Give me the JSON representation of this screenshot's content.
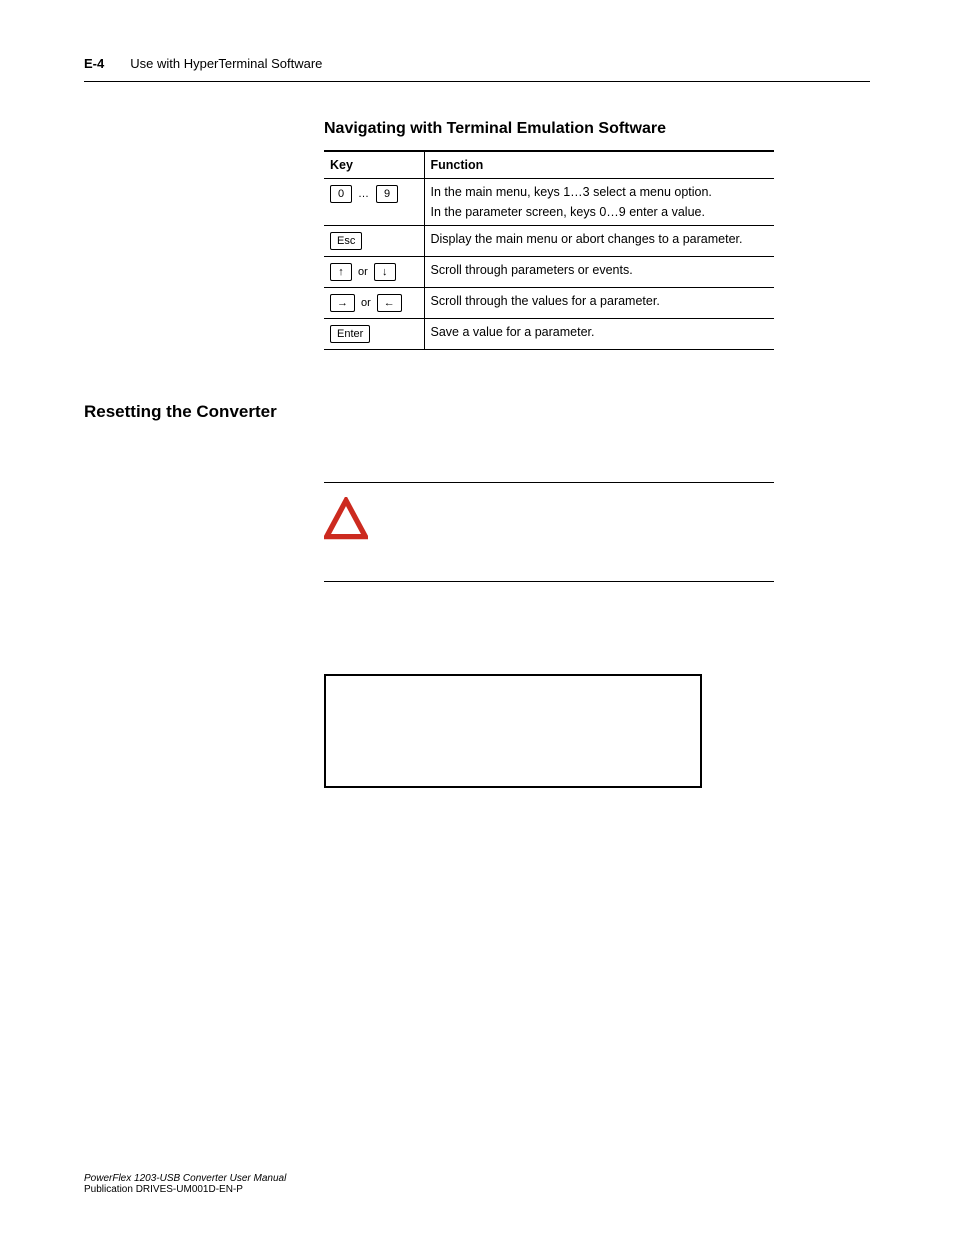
{
  "header": {
    "page_number": "E-4",
    "running_title": "Use with HyperTerminal Software"
  },
  "subheading": "Navigating with Terminal Emulation Software",
  "table": {
    "headers": {
      "key": "Key",
      "function": "Function"
    },
    "rows": [
      {
        "key_left": "0",
        "key_sep": "…",
        "key_right": "9",
        "function_line1": "In the main menu, keys 1…3 select a menu option.",
        "function_line2": "In the parameter screen, keys 0…9 enter a value."
      },
      {
        "key_single": "Esc",
        "function": "Display the main menu or abort changes to a parameter."
      },
      {
        "key_left_glyph": "↑",
        "key_sep": "or",
        "key_right_glyph": "↓",
        "function": "Scroll through parameters or events."
      },
      {
        "key_left_glyph": "→",
        "key_sep": "or",
        "key_right_glyph": "←",
        "function": "Scroll through the values for a parameter."
      },
      {
        "key_single": "Enter",
        "function": "Save a value for a parameter."
      }
    ]
  },
  "left_heading": "Resetting the Converter",
  "footer": {
    "title": "PowerFlex 1203-USB Converter User Manual",
    "pub": "Publication DRIVES-UM001D-EN-P"
  }
}
